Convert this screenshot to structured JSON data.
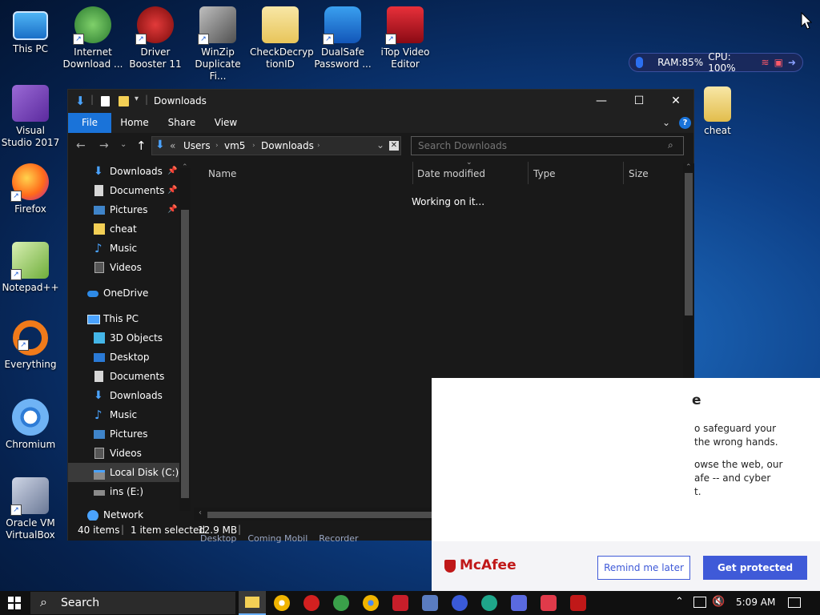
{
  "desktop": {
    "icons": [
      {
        "label": "This PC"
      },
      {
        "label": "Internet Download ..."
      },
      {
        "label": "Driver Booster 11"
      },
      {
        "label": "WinZip Duplicate Fi..."
      },
      {
        "label": "CheckDecryp tionID"
      },
      {
        "label": "DualSafe Password ..."
      },
      {
        "label": "iTop Video Editor"
      },
      {
        "label": "Visual Studio 2017"
      },
      {
        "label": "Firefox"
      },
      {
        "label": "Notepad++"
      },
      {
        "label": "Everything"
      },
      {
        "label": "Chromium"
      },
      {
        "label": "Oracle VM VirtualBox"
      },
      {
        "label": "cheat"
      }
    ]
  },
  "sysmon": {
    "ram": "RAM:85%",
    "cpu": "CPU: 100%"
  },
  "explorer": {
    "title": "Downloads",
    "ribbon": {
      "file": "File",
      "home": "Home",
      "share": "Share",
      "view": "View"
    },
    "address": {
      "sep": "«",
      "crumbs": [
        "Users",
        "vm5",
        "Downloads"
      ]
    },
    "search": {
      "placeholder": "Search Downloads"
    },
    "nav": {
      "quick": [
        "Downloads",
        "Documents",
        "Pictures",
        "cheat",
        "Music",
        "Videos"
      ],
      "onedrive": "OneDrive",
      "thispc": "This PC",
      "pc_items": [
        "3D Objects",
        "Desktop",
        "Documents",
        "Downloads",
        "Music",
        "Pictures",
        "Videos",
        "Local Disk (C:)",
        "ins (E:)"
      ],
      "network": "Network"
    },
    "columns": {
      "name": "Name",
      "date": "Date modified",
      "type": "Type",
      "size": "Size"
    },
    "working": "Working on it...",
    "status": {
      "items": "40 items",
      "selected": "1 item selected",
      "size": "12.9 MB"
    }
  },
  "mcafee": {
    "partial_heading": "e",
    "line1": "o safeguard your",
    "line2": "the wrong hands.",
    "line3": "owse the web, our",
    "line4": "afe -- and cyber",
    "line5": "t.",
    "logo": "McAfee",
    "remind": "Remind me later",
    "protect": "Get protected"
  },
  "behind_text": "Desktop    Coming Mobil    Recorder",
  "taskbar": {
    "search": "Search",
    "time": "5:09 AM"
  }
}
